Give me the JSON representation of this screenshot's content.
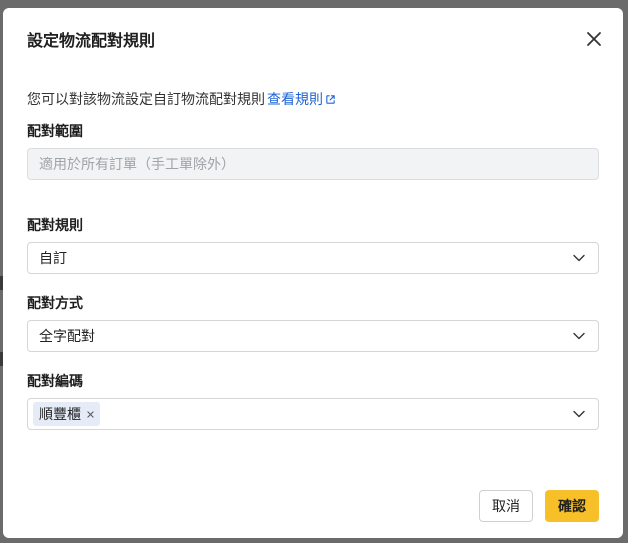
{
  "modal": {
    "title": "設定物流配對規則",
    "description": "您可以對該物流設定自訂物流配對規則",
    "rules_link": "查看規則"
  },
  "fields": {
    "scope": {
      "label": "配對範圍",
      "placeholder": "適用於所有訂單（手工單除外）"
    },
    "rule": {
      "label": "配對規則",
      "value": "自訂"
    },
    "method": {
      "label": "配對方式",
      "value": "全字配對"
    },
    "codes": {
      "label": "配對編碼",
      "tags": [
        "順豐櫃"
      ]
    }
  },
  "footer": {
    "cancel_label": "取消",
    "confirm_label": "確認"
  },
  "colors": {
    "accent": "#f7c028",
    "link": "#1e63d6"
  },
  "icons": {
    "close": "close-icon",
    "external_link": "external-link-icon",
    "dropdown": "chevron-down-icon",
    "tag_remove": "x-icon"
  }
}
